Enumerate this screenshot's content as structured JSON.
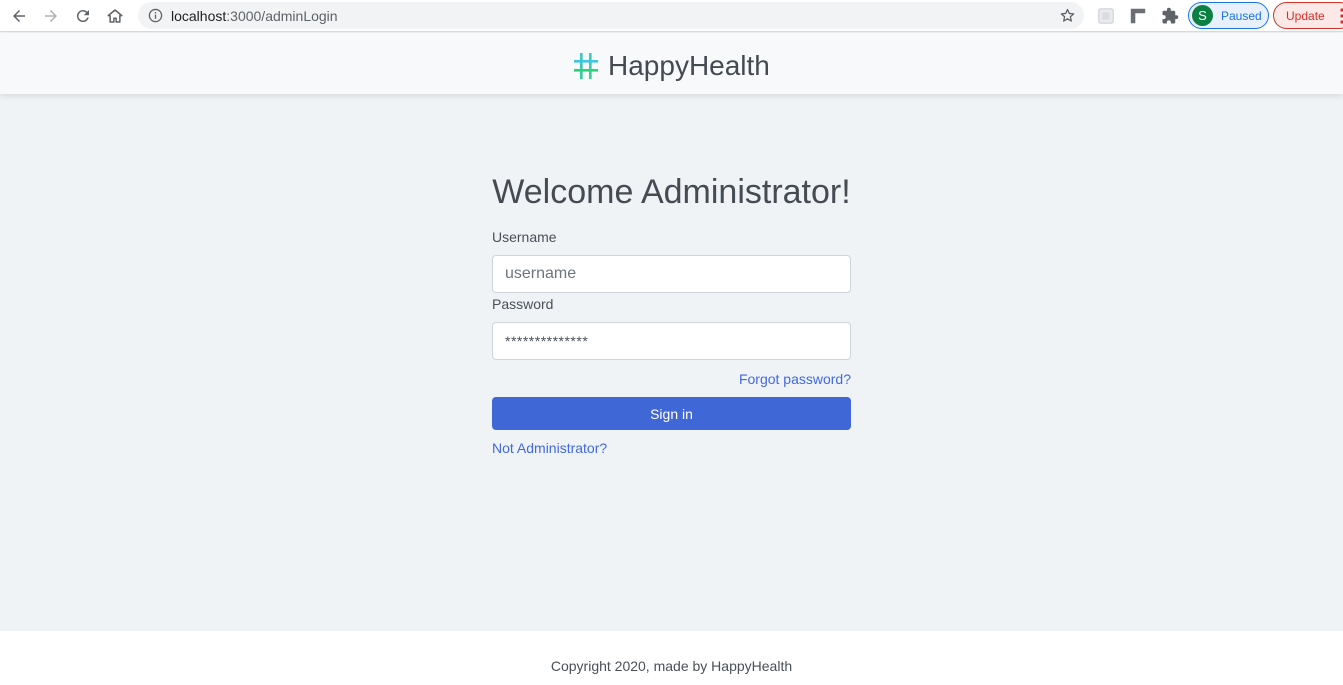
{
  "browser": {
    "url_host": "localhost",
    "url_path": ":3000/adminLogin",
    "profile_initial": "S",
    "profile_status": "Paused",
    "update_label": "Update",
    "icons": [
      "back-icon",
      "forward-icon",
      "reload-icon",
      "home-icon",
      "info-icon",
      "star-icon",
      "extension-icon",
      "puzzle-icon",
      "more-vert-icon"
    ]
  },
  "header": {
    "brand": "HappyHealth",
    "logo_icon": "hash-icon"
  },
  "login": {
    "title": "Welcome Administrator!",
    "username_label": "Username",
    "username_placeholder": "username",
    "password_label": "Password",
    "password_value": "**************",
    "forgot_link": "Forgot password?",
    "signin_button": "Sign in",
    "not_admin_link": "Not Administrator?"
  },
  "footer": {
    "copyright": "Copyright 2020, made by HappyHealth"
  },
  "colors": {
    "page_bg": "#eff3f6",
    "primary": "#3f67d6",
    "link": "#4169e1"
  }
}
